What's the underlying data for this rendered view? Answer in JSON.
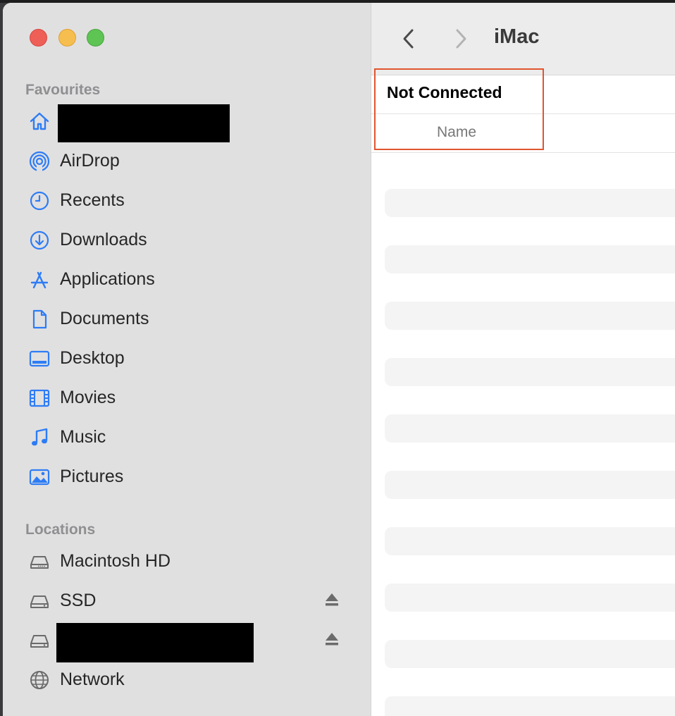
{
  "window": {
    "title": "iMac"
  },
  "sidebar": {
    "favourites_title": "Favourites",
    "locations_title": "Locations",
    "favourites": [
      {
        "label": "",
        "icon": "home-icon",
        "redacted": true
      },
      {
        "label": "AirDrop",
        "icon": "airdrop-icon"
      },
      {
        "label": "Recents",
        "icon": "clock-icon"
      },
      {
        "label": "Downloads",
        "icon": "download-icon"
      },
      {
        "label": "Applications",
        "icon": "applications-icon"
      },
      {
        "label": "Documents",
        "icon": "document-icon"
      },
      {
        "label": "Desktop",
        "icon": "desktop-icon"
      },
      {
        "label": "Movies",
        "icon": "film-icon"
      },
      {
        "label": "Music",
        "icon": "music-note-icon"
      },
      {
        "label": "Pictures",
        "icon": "photo-icon"
      }
    ],
    "locations": [
      {
        "label": "Macintosh HD",
        "icon": "internal-drive-icon"
      },
      {
        "label": "SSD",
        "icon": "external-drive-icon",
        "ejectable": true
      },
      {
        "label": "",
        "icon": "external-drive-icon",
        "ejectable": true,
        "redacted": true
      },
      {
        "label": "Network",
        "icon": "globe-icon"
      }
    ]
  },
  "main": {
    "status": "Not Connected",
    "column_header": "Name"
  },
  "colors": {
    "accent": "#2d7cf6",
    "highlight_border": "#e0552f",
    "sidebar_bg": "#e1e0e1"
  }
}
